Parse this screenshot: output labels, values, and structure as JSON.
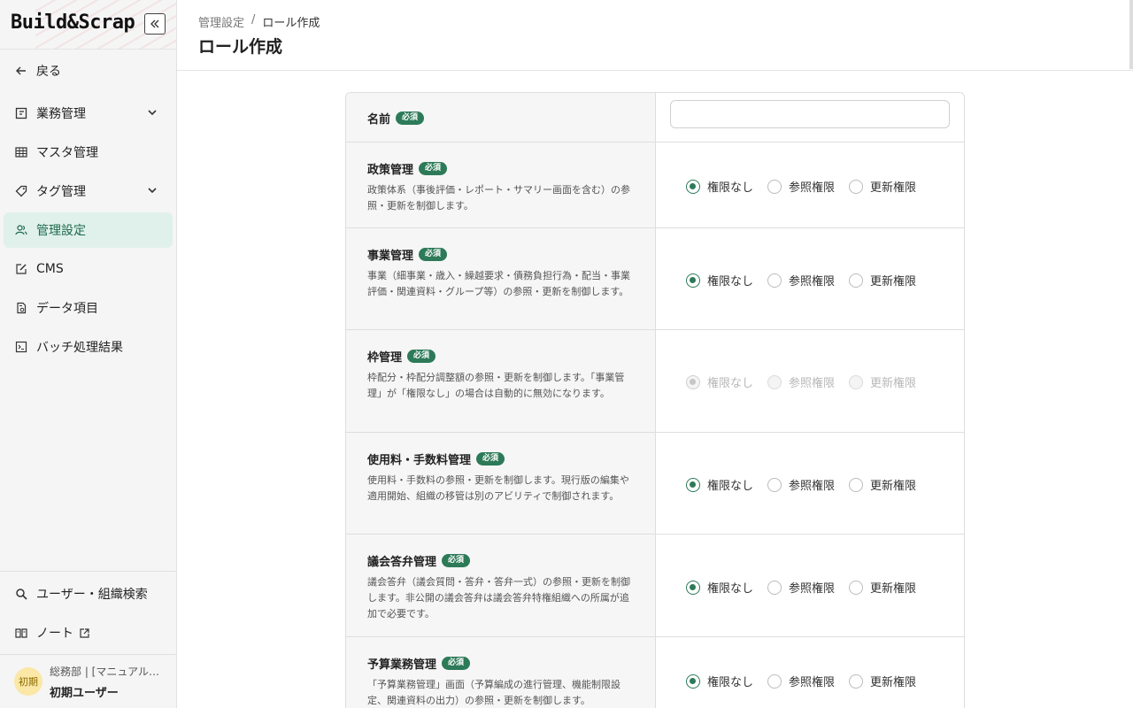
{
  "brand": {
    "logo_text": "Build&Scrap"
  },
  "sidebar": {
    "back_label": "戻る",
    "items": [
      {
        "label": "業務管理",
        "icon": "board-icon"
      },
      {
        "label": "マスタ管理",
        "icon": "table-icon"
      },
      {
        "label": "タグ管理",
        "icon": "tag-icon"
      },
      {
        "label": "管理設定",
        "icon": "users-icon"
      },
      {
        "label": "CMS",
        "icon": "edit-icon"
      },
      {
        "label": "データ項目",
        "icon": "document-icon"
      },
      {
        "label": "バッチ処理結果",
        "icon": "terminal-icon"
      }
    ],
    "bottom_items": [
      {
        "label": "ユーザー・組織検索",
        "icon": "search-icon"
      },
      {
        "label": "ノート",
        "icon": "book-icon"
      }
    ],
    "user": {
      "avatar": "初期",
      "dept": "総務部 | [マニュアル…",
      "name": "初期ユーザー"
    }
  },
  "header": {
    "breadcrumb": [
      "管理設定",
      "ロール作成"
    ],
    "separator": "/",
    "title": "ロール作成"
  },
  "form": {
    "required_badge": "必須",
    "name_field": {
      "label": "名前",
      "value": "",
      "placeholder": ""
    },
    "options": [
      "権限なし",
      "参照権限",
      "更新権限"
    ],
    "rows": [
      {
        "title": "政策管理",
        "desc": "政策体系（事後評価・レポート・サマリー画面を含む）の参照・更新を制御します。",
        "selected": "権限なし",
        "disabled": false
      },
      {
        "title": "事業管理",
        "desc": "事業（細事業・歳入・繰越要求・債務負担行為・配当・事業評価・関連資料・グループ等）の参照・更新を制御します。",
        "selected": "権限なし",
        "disabled": false
      },
      {
        "title": "枠管理",
        "desc": "枠配分・枠配分調整額の参照・更新を制御します。「事業管理」が「権限なし」の場合は自動的に無効になります。",
        "selected": "権限なし",
        "disabled": true
      },
      {
        "title": "使用料・手数料管理",
        "desc": "使用料・手数料の参照・更新を制御します。現行版の編集や適用開始、組織の移管は別のアビリティで制御されます。",
        "selected": "権限なし",
        "disabled": false
      },
      {
        "title": "議会答弁管理",
        "desc": "議会答弁（議会質問・答弁・答弁一式）の参照・更新を制御します。非公開の議会答弁は議会答弁特権組織への所属が追加で必要です。",
        "selected": "権限なし",
        "disabled": false
      },
      {
        "title": "予算業務管理",
        "desc": "「予算業務管理」画面（予算編成の進行管理、機能制限設定、関連資料の出力）の参照・更新を制御します。",
        "selected": "権限なし",
        "disabled": false
      }
    ]
  },
  "colors": {
    "accent": "#2d7a58",
    "active_bg": "#e0f0ea"
  }
}
